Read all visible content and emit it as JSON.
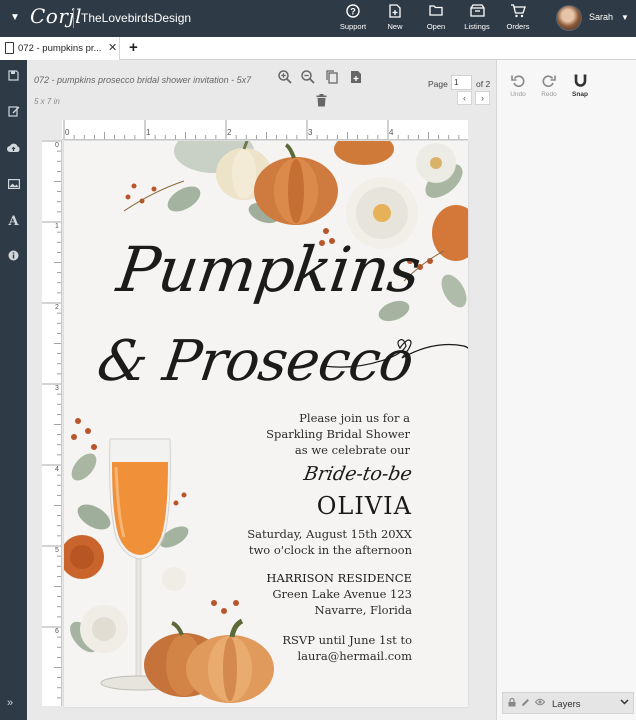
{
  "app": {
    "logo": "Corjl",
    "shop_name": "TheLovebirdsDesign",
    "nav": [
      {
        "label": "Support",
        "icon": "help-circle-icon"
      },
      {
        "label": "New",
        "icon": "new-file-icon"
      },
      {
        "label": "Open",
        "icon": "folder-icon"
      },
      {
        "label": "Listings",
        "icon": "listings-icon"
      },
      {
        "label": "Orders",
        "icon": "cart-icon"
      }
    ],
    "user": {
      "name": "Sarah"
    }
  },
  "tabs": [
    {
      "label": "072 - pumpkins pr..."
    }
  ],
  "document": {
    "title": "072 - pumpkins prosecco bridal shower invitation - 5x7",
    "size": "5 x 7 in",
    "page": {
      "label": "Page",
      "current": "1",
      "of": "of 2"
    }
  },
  "ruler": {
    "top_labels": [
      "0",
      "1",
      "2",
      "3",
      "4"
    ],
    "left_labels": [
      "0",
      "1",
      "2",
      "3",
      "4",
      "5",
      "6"
    ]
  },
  "invite": {
    "script_line1": "Pumpkins",
    "script_line2": "& Prosecco",
    "lines": [
      "Please join us for a",
      "Sparkling Bridal Shower",
      "as we celebrate our"
    ],
    "bride_label": "Bride-to-be",
    "bride_name": "OLIVIA",
    "date": "Saturday, August 15th 20XX",
    "time": "two o'clock in the afternoon",
    "venue": "HARRISON RESIDENCE",
    "address1": "Green Lake Avenue 123",
    "address2": "Navarre, Florida",
    "rsvp": "RSVP until June 1st to",
    "email": "laura@hermail.com"
  },
  "right_panel": {
    "undo": "Undo",
    "redo": "Redo",
    "snap": "Snap",
    "layers": "Layers"
  },
  "colors": {
    "topbar": "#2e3a46",
    "pumpkin": "#d07a3a",
    "sage": "#a9b6a2"
  }
}
